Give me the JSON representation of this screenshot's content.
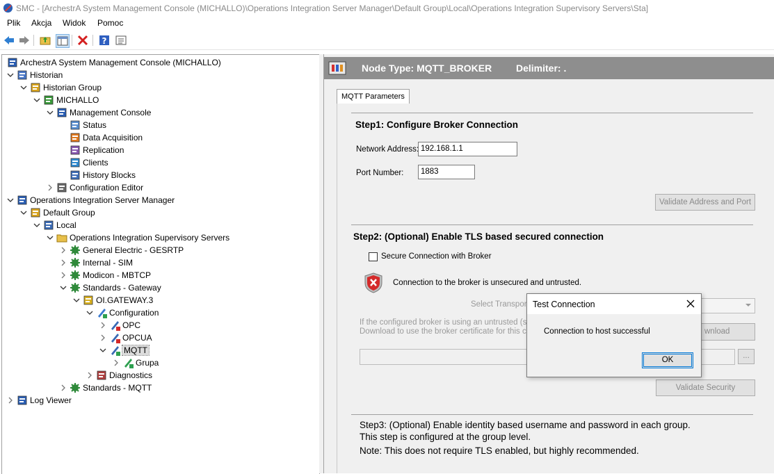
{
  "window": {
    "title": "SMC - [ArchestrA System Management Console (MICHALLO)\\Operations Integration Server Manager\\Default Group\\Local\\Operations Integration Supervisory Servers\\Sta]"
  },
  "menu": [
    "Plik",
    "Akcja",
    "Widok",
    "Pomoc"
  ],
  "toolbar": {
    "buttons": [
      "back-icon",
      "forward-icon",
      "up-folder-icon",
      "show-hide-tree-icon",
      "delete-icon",
      "help-icon",
      "properties-icon"
    ]
  },
  "tree": {
    "items": [
      {
        "label": "ArchestrA System Management Console (MICHALLO)",
        "icon": "console-icon"
      },
      {
        "label": "Historian",
        "icon": "historian-icon"
      },
      {
        "label": "Historian Group",
        "icon": "group-icon"
      },
      {
        "label": "MICHALLO",
        "icon": "server-icon"
      },
      {
        "label": "Management Console",
        "icon": "console-icon"
      },
      {
        "label": "Status",
        "icon": "status-icon"
      },
      {
        "label": "Data Acquisition",
        "icon": "data-acquisition-icon"
      },
      {
        "label": "Replication",
        "icon": "replication-icon"
      },
      {
        "label": "Clients",
        "icon": "clients-icon"
      },
      {
        "label": "History Blocks",
        "icon": "history-blocks-icon"
      },
      {
        "label": "Configuration Editor",
        "icon": "config-editor-icon"
      },
      {
        "label": "Operations Integration Server Manager",
        "icon": "oi-manager-icon"
      },
      {
        "label": "Default Group",
        "icon": "group-icon"
      },
      {
        "label": "Local",
        "icon": "computer-icon"
      },
      {
        "label": "Operations Integration Supervisory Servers",
        "icon": "folder-icon"
      },
      {
        "label": "General Electric - GESRTP",
        "icon": "gear-icon"
      },
      {
        "label": "Internal - SIM",
        "icon": "gear-icon"
      },
      {
        "label": "Modicon - MBTCP",
        "icon": "gear-icon"
      },
      {
        "label": "Standards - Gateway",
        "icon": "gear-icon"
      },
      {
        "label": "OI.GATEWAY.3",
        "icon": "gateway-icon"
      },
      {
        "label": "Configuration",
        "icon": "configuration-icon"
      },
      {
        "label": "OPC",
        "icon": "opc-icon"
      },
      {
        "label": "OPCUA",
        "icon": "opcua-icon"
      },
      {
        "label": "MQTT",
        "icon": "mqtt-icon"
      },
      {
        "label": "Grupa",
        "icon": "group-node-icon"
      },
      {
        "label": "Diagnostics",
        "icon": "diagnostics-icon"
      },
      {
        "label": "Standards - MQTT",
        "icon": "gear-icon"
      },
      {
        "label": "Log Viewer",
        "icon": "log-viewer-icon"
      }
    ]
  },
  "node_header": {
    "node_type": "Node Type: MQTT_BROKER",
    "delimiter": "Delimiter:  ."
  },
  "tabs": [
    "MQTT Parameters"
  ],
  "step1": {
    "title": "Step1: Configure Broker Connection",
    "network_address_label": "Network Address:",
    "network_address_value": "192.168.1.1",
    "port_label": "Port Number:",
    "port_value": "1883",
    "validate_button": "Validate Address and Port"
  },
  "step2": {
    "title": "Step2: (Optional) Enable TLS based secured connection",
    "secure_checkbox_label": "Secure Connection with Broker",
    "secure_checked": false,
    "status_text": "Connection to the broker is unsecured and untrusted.",
    "transport_label": "Select Transport",
    "info_line1": "If the configured broker is using an untrusted (self-s",
    "info_line2": "Download to use the broker certificate for this conn",
    "download_button": "wnload",
    "browse_button": "...",
    "validate_security_button": "Validate Security"
  },
  "step3": {
    "line1": "Step3: (Optional) Enable identity based username and password in each group.",
    "line2": "This step is configured at the group level.",
    "line3": "Note: This does not require TLS enabled, but highly recommended."
  },
  "dialog": {
    "title": "Test Connection",
    "message": "Connection to host successful",
    "ok_button": "OK"
  }
}
